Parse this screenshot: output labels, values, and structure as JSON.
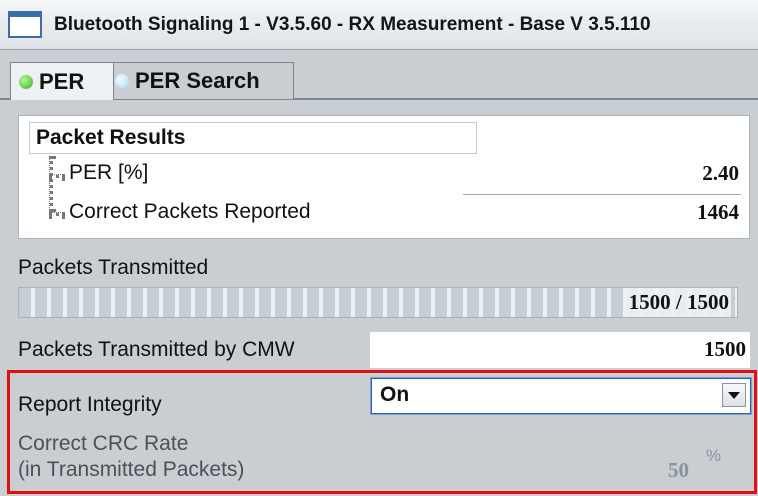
{
  "window": {
    "title": "Bluetooth Signaling 1 - V3.5.60 - RX Measurement - Base V 3.5.110"
  },
  "tabs": [
    {
      "label": "PER",
      "status": "green"
    },
    {
      "label": "PER Search",
      "status": "light-blue"
    }
  ],
  "packet_results": {
    "header": "Packet Results",
    "rows": [
      {
        "label": "PER [%]",
        "value": "2.40"
      },
      {
        "label": "Correct Packets Reported",
        "value": "1464"
      }
    ]
  },
  "packets_transmitted": {
    "label": "Packets Transmitted",
    "progress_text": "1500 / 1500",
    "progress_fraction": 1.0
  },
  "packets_transmitted_by_cmw": {
    "label": "Packets Transmitted by CMW",
    "value": "1500"
  },
  "report_integrity": {
    "label": "Report Integrity",
    "selected": "On"
  },
  "correct_crc_rate": {
    "label_line1": "Correct CRC Rate",
    "label_line2": "(in Transmitted Packets)",
    "value": "50",
    "unit": "%"
  },
  "colors": {
    "highlight": "#e01010",
    "accent": "#2f5fa8"
  }
}
